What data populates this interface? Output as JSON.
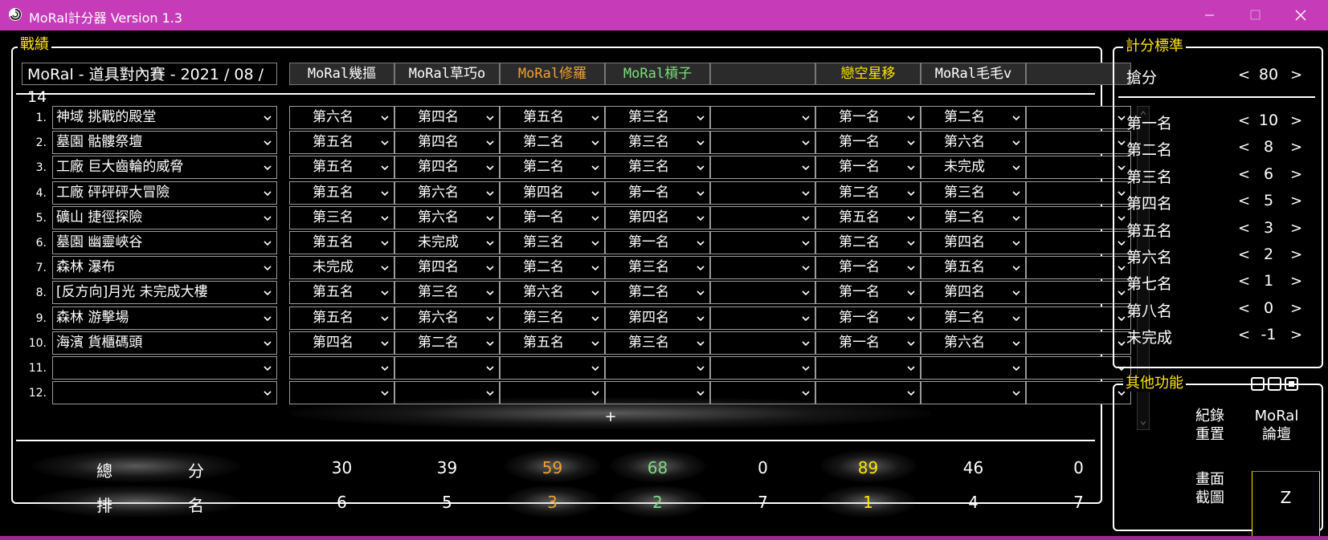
{
  "window": {
    "title": "MoRal計分器 Version 1.3",
    "titlebar_color": "#c63cb8"
  },
  "records": {
    "group_label": "戰績",
    "tournament": "MoRal - 道具對內賽 - 2021 / 08 / 14",
    "players": [
      {
        "name": "MoRal幾摳",
        "color": "#ffffff"
      },
      {
        "name": "MoRal草巧o",
        "color": "#ffffff"
      },
      {
        "name": "MoRal修羅",
        "color": "#f0a030"
      },
      {
        "name": "MoRal槓子",
        "color": "#7ddf7d"
      },
      {
        "name": "",
        "color": "#ffffff"
      },
      {
        "name": "戀空星移",
        "color": "#ffe600"
      },
      {
        "name": "MoRal毛毛v",
        "color": "#ffffff"
      },
      {
        "name": "",
        "color": "#ffffff"
      }
    ],
    "rows": [
      {
        "num": "1.",
        "map": "神域 挑戰的殿堂",
        "ranks": [
          "第六名",
          "第四名",
          "第五名",
          "第三名",
          "",
          "第一名",
          "第二名",
          ""
        ]
      },
      {
        "num": "2.",
        "map": "墓園 骷髏祭壇",
        "ranks": [
          "第五名",
          "第四名",
          "第二名",
          "第三名",
          "",
          "第一名",
          "第六名",
          ""
        ]
      },
      {
        "num": "3.",
        "map": "工廠 巨大齒輪的威脅",
        "ranks": [
          "第五名",
          "第四名",
          "第二名",
          "第三名",
          "",
          "第一名",
          "未完成",
          ""
        ]
      },
      {
        "num": "4.",
        "map": "工廠 砰砰砰大冒險",
        "ranks": [
          "第五名",
          "第六名",
          "第四名",
          "第一名",
          "",
          "第二名",
          "第三名",
          ""
        ]
      },
      {
        "num": "5.",
        "map": "礦山 捷徑探險",
        "ranks": [
          "第三名",
          "第六名",
          "第一名",
          "第四名",
          "",
          "第五名",
          "第二名",
          ""
        ]
      },
      {
        "num": "6.",
        "map": "墓園 幽靈峽谷",
        "ranks": [
          "第五名",
          "未完成",
          "第三名",
          "第一名",
          "",
          "第二名",
          "第四名",
          ""
        ]
      },
      {
        "num": "7.",
        "map": "森林 瀑布",
        "ranks": [
          "未完成",
          "第四名",
          "第二名",
          "第三名",
          "",
          "第一名",
          "第五名",
          ""
        ]
      },
      {
        "num": "8.",
        "map": "[反方向]月光 未完成大樓",
        "ranks": [
          "第五名",
          "第三名",
          "第六名",
          "第二名",
          "",
          "第一名",
          "第四名",
          ""
        ]
      },
      {
        "num": "9.",
        "map": "森林 游擊場",
        "ranks": [
          "第五名",
          "第六名",
          "第三名",
          "第四名",
          "",
          "第一名",
          "第二名",
          ""
        ]
      },
      {
        "num": "10.",
        "map": "海濱 貨櫃碼頭",
        "ranks": [
          "第四名",
          "第二名",
          "第五名",
          "第三名",
          "",
          "第一名",
          "第六名",
          ""
        ]
      },
      {
        "num": "11.",
        "map": "",
        "ranks": [
          "",
          "",
          "",
          "",
          "",
          "",
          "",
          ""
        ]
      },
      {
        "num": "12.",
        "map": "",
        "ranks": [
          "",
          "",
          "",
          "",
          "",
          "",
          "",
          ""
        ]
      }
    ],
    "add_label": "+",
    "total_label_a": "總",
    "total_label_b": "分",
    "rank_label_a": "排",
    "rank_label_b": "名",
    "totals": [
      "30",
      "39",
      "59",
      "68",
      "0",
      "89",
      "46",
      "0"
    ],
    "placements": [
      "6",
      "5",
      "3",
      "2",
      "7",
      "1",
      "4",
      "7"
    ]
  },
  "standard": {
    "group_label": "計分標準",
    "grab": {
      "label": "搶分",
      "value": "80"
    },
    "items": [
      {
        "label": "第一名",
        "value": "10"
      },
      {
        "label": "第二名",
        "value": "8"
      },
      {
        "label": "第三名",
        "value": "6"
      },
      {
        "label": "第四名",
        "value": "5"
      },
      {
        "label": "第五名",
        "value": "3"
      },
      {
        "label": "第六名",
        "value": "2"
      },
      {
        "label": "第七名",
        "value": "1"
      },
      {
        "label": "第八名",
        "value": "0"
      },
      {
        "label": "未完成",
        "value": "-1"
      }
    ],
    "dec": "<",
    "inc": ">"
  },
  "functions": {
    "group_label": "其他功能",
    "reset_l1": "紀錄",
    "reset_l2": "重置",
    "forum_l1": "MoRal",
    "forum_l2": "論壇",
    "shot_l1": "畫面",
    "shot_l2": "截圖",
    "z_label": "Z"
  },
  "colors": {
    "accent_yellow": "#ffe600",
    "orange": "#f0a030",
    "green": "#7ddf7d"
  }
}
